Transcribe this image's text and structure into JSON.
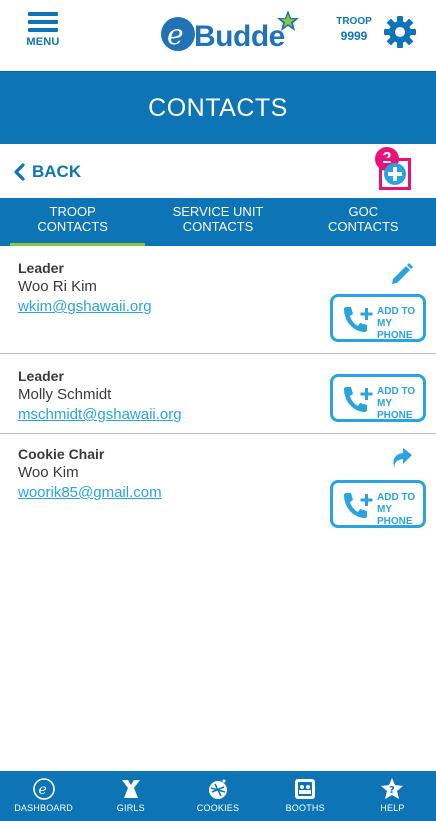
{
  "header": {
    "menu_label": "MENU",
    "brand_prefix": "e",
    "brand_name": "Budde",
    "troop_label": "TROOP",
    "troop_number": "9999"
  },
  "page": {
    "title": "CONTACTS",
    "back_label": "BACK",
    "badge_number": "2"
  },
  "tabs": [
    {
      "line1": "TROOP",
      "line2": "CONTACTS",
      "active": true
    },
    {
      "line1": "SERVICE UNIT",
      "line2": "CONTACTS",
      "active": false
    },
    {
      "line1": "GOC",
      "line2": "CONTACTS",
      "active": false
    }
  ],
  "contacts": [
    {
      "role": "Leader",
      "name": "Woo Ri Kim",
      "email": "wkim@gshawaii.org",
      "action_icon": "pencil-icon"
    },
    {
      "role": "Leader",
      "name": "Molly Schmidt",
      "email": "mschmidt@gshawaii.org",
      "action_icon": ""
    },
    {
      "role": "Cookie Chair",
      "name": "Woo Kim",
      "email": "woorik85@gmail.com",
      "action_icon": "share-arrow-icon"
    }
  ],
  "add_to_phone": {
    "line1": "ADD TO",
    "line2": "MY PHONE"
  },
  "bottom_nav": [
    {
      "label": "DASHBOARD",
      "icon": "e-logo-icon"
    },
    {
      "label": "GIRLS",
      "icon": "girl-icon"
    },
    {
      "label": "COOKIES",
      "icon": "cookie-icon"
    },
    {
      "label": "BOOTHS",
      "icon": "booth-icon"
    },
    {
      "label": "HELP",
      "icon": "help-icon"
    }
  ],
  "colors": {
    "primary_blue": "#0d74b6",
    "link_blue": "#2aa3df",
    "highlight_pink": "#e6147a",
    "active_tab_green": "#8cc63f"
  }
}
